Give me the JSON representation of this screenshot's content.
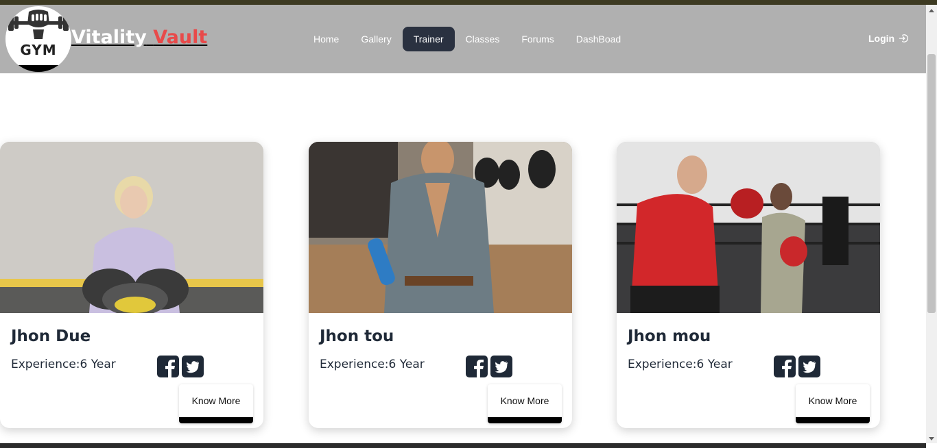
{
  "brand": {
    "logo_text": "GYM",
    "name_part1": "Vitality",
    "name_part2": "Vault"
  },
  "nav": {
    "items": [
      {
        "label": "Home",
        "active": false
      },
      {
        "label": "Gallery",
        "active": false
      },
      {
        "label": "Trainer",
        "active": true
      },
      {
        "label": "Classes",
        "active": false
      },
      {
        "label": "Forums",
        "active": false
      },
      {
        "label": "DashBoad",
        "active": false
      }
    ],
    "login_label": "Login"
  },
  "trainers": [
    {
      "name": "Jhon Due",
      "experience": "Experience:6 Year",
      "button": "Know More"
    },
    {
      "name": "Jhon tou",
      "experience": "Experience:6 Year",
      "button": "Know More"
    },
    {
      "name": "Jhon mou",
      "experience": "Experience:6 Year",
      "button": "Know More"
    }
  ],
  "colors": {
    "navbar": "#b0b0b0",
    "active_nav": "#2a3140",
    "brand_accent": "#e84a4a",
    "text_dark": "#1f2937"
  },
  "icons": {
    "login": "login-icon",
    "facebook": "facebook-icon",
    "twitter": "twitter-icon"
  }
}
